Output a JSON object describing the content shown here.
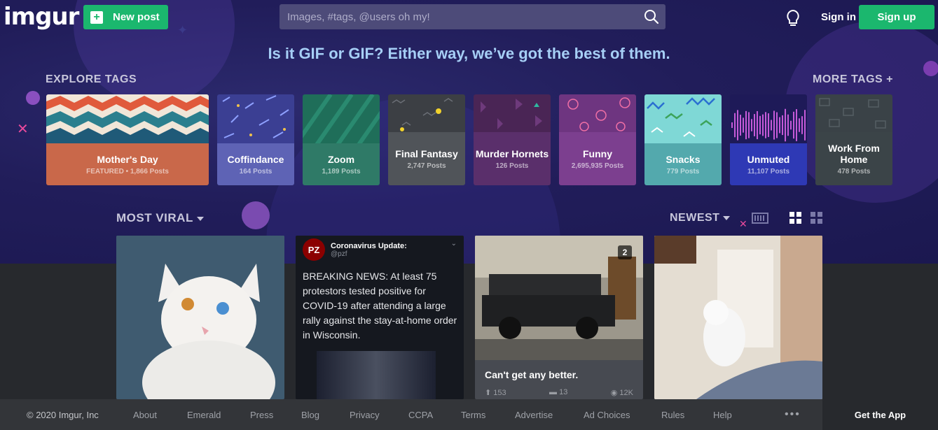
{
  "header": {
    "logo": "imgur",
    "new_post": "New post",
    "search_placeholder": "Images, #tags, @users oh my!",
    "sign_in": "Sign in",
    "sign_up": "Sign up"
  },
  "tagline": "Is it GIF or GIF? Either way, we’ve got the best of them.",
  "explore": {
    "title": "EXPLORE TAGS",
    "more": "MORE TAGS +",
    "tags": [
      {
        "name": "Mother's Day",
        "posts": "FEATURED • 1,866 Posts",
        "color": "#c9684a"
      },
      {
        "name": "Coffindance",
        "posts": "164 Posts",
        "color": "#5e63b5"
      },
      {
        "name": "Zoom",
        "posts": "1,189 Posts",
        "color": "#2f7a67"
      },
      {
        "name": "Final Fantasy",
        "posts": "2,747 Posts",
        "color": "#505459"
      },
      {
        "name": "Murder Hornets",
        "posts": "126 Posts",
        "color": "#5a2f6b"
      },
      {
        "name": "Funny",
        "posts": "2,695,935 Posts",
        "color": "#7c3f8f"
      },
      {
        "name": "Snacks",
        "posts": "779 Posts",
        "color": "#53a9ad"
      },
      {
        "name": "Unmuted",
        "posts": "11,107 Posts",
        "color": "#2e39b5"
      },
      {
        "name": "Work From Home",
        "posts": "478 Posts",
        "color": "#3b4448"
      }
    ]
  },
  "gallery": {
    "sort_label": "MOST VIRAL",
    "order_label": "NEWEST",
    "tweet": {
      "avatar": "PZ",
      "name": "Coronavirus Update:",
      "handle": "@pzf",
      "body": "BREAKING NEWS: At least 75 protestors tested positive for COVID-19 after attending a large rally against the stay-at-home order in Wisconsin."
    },
    "post3": {
      "badge": "2",
      "caption": "Can't get any better.",
      "upvotes": "153",
      "comments": "13",
      "views": "12K"
    }
  },
  "footer": {
    "copyright": "© 2020 Imgur, Inc",
    "links": [
      "About",
      "Emerald",
      "Press",
      "Blog",
      "Privacy",
      "CCPA",
      "Terms",
      "Advertise",
      "Ad Choices",
      "Rules",
      "Help"
    ],
    "more": "•••",
    "get_app": "Get the App"
  },
  "colors": {
    "accent_green": "#1bb76e",
    "hero_bg": "#211d5a",
    "tagline": "#a6cff6"
  }
}
